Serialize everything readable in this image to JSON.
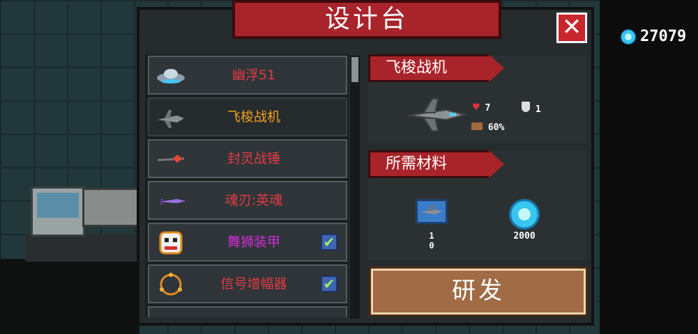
{
  "header": {
    "title": "设计台",
    "close_label": "✕"
  },
  "currency": {
    "value": "27079",
    "icon": "gem-icon"
  },
  "list": {
    "items": [
      {
        "name": "幽浮51",
        "color": "#e23b45",
        "icon": "ufo-icon",
        "checked": false
      },
      {
        "name": "飞梭战机",
        "color": "#f0a020",
        "icon": "jet-fighter-icon",
        "checked": false
      },
      {
        "name": "封灵战锤",
        "color": "#e23b45",
        "icon": "war-hammer-icon",
        "checked": false
      },
      {
        "name": "魂刃:英魂",
        "color": "#e23b45",
        "icon": "soul-blade-icon",
        "checked": false
      },
      {
        "name": "舞狮装甲",
        "color": "#d02ed8",
        "icon": "lion-dance-armor-icon",
        "checked": true
      },
      {
        "name": "信号增幅器",
        "color": "#e23b45",
        "icon": "signal-amplifier-icon",
        "checked": true
      }
    ],
    "check_mark": "✔"
  },
  "detail": {
    "name": "飞梭战机",
    "hp": "7",
    "armor": "1",
    "speed": "60%"
  },
  "materials": {
    "title": "所需材料",
    "blueprint_qty": "1",
    "blueprint_sub": "0",
    "gem_qty": "2000"
  },
  "build_button": "研发",
  "colors": {
    "accent_red": "#a8232a",
    "panel": "#262b2d",
    "build": "#a06b45"
  }
}
